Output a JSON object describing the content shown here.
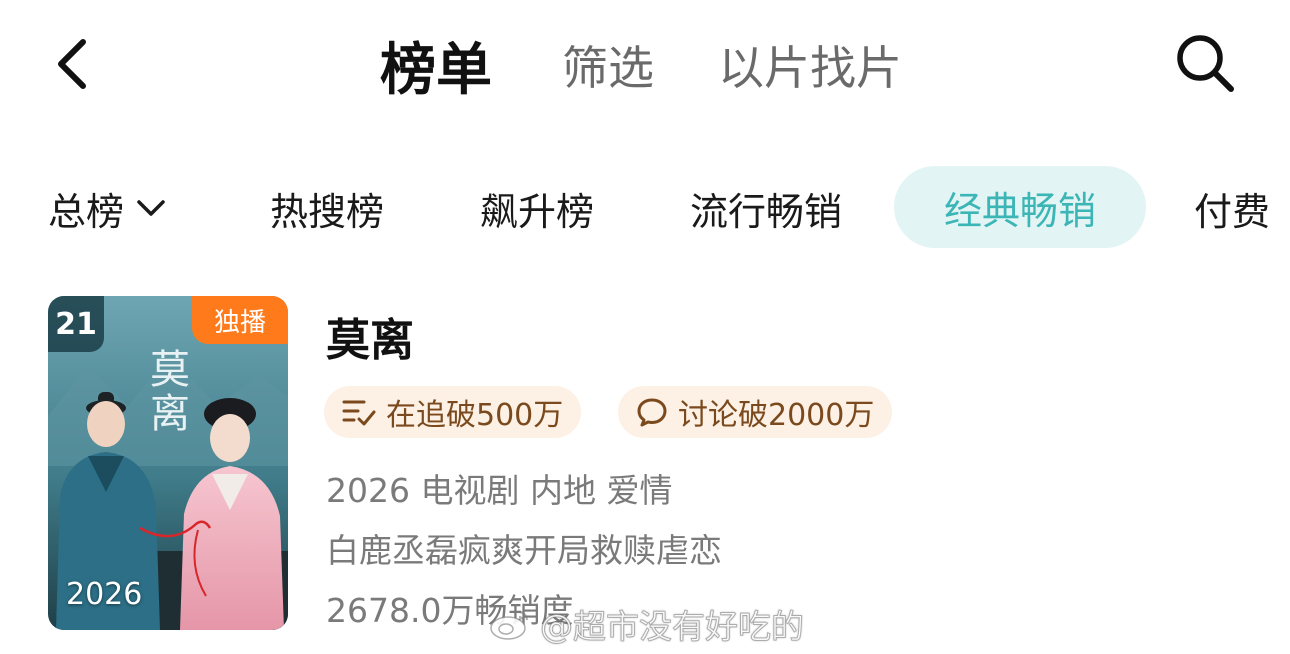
{
  "header": {
    "back_icon": "chevron-left-icon",
    "tabs": [
      {
        "label": "榜单",
        "active": true
      },
      {
        "label": "筛选",
        "active": false
      },
      {
        "label": "以片找片",
        "active": false
      }
    ],
    "search_icon": "search-icon"
  },
  "categories": [
    {
      "label": "总榜",
      "has_dropdown": true
    },
    {
      "label": "热搜榜"
    },
    {
      "label": "飙升榜"
    },
    {
      "label": "流行畅销"
    },
    {
      "label": "经典畅销",
      "active": true
    },
    {
      "label": "付费"
    }
  ],
  "item": {
    "rank": "21",
    "exclusive_badge": "独播",
    "poster_title_art": "莫离",
    "poster_year": "2026",
    "title": "莫离",
    "tags": [
      {
        "icon": "list-check-icon",
        "label": "在追破500万"
      },
      {
        "icon": "comment-icon",
        "label": "讨论破2000万"
      }
    ],
    "meta_line": "2026 电视剧 内地 爱情",
    "description": "白鹿丞磊疯爽开局救赎虐恋",
    "sales": "2678.0万畅销度"
  },
  "watermark": "@超市没有好吃的",
  "colors": {
    "accent": "#3bb5b5",
    "accent_bg": "#e2f4f4",
    "badge_orange": "#ff7a1a",
    "tag_bg": "#fdf0e4",
    "tag_text": "#7a4a1e",
    "meta_text": "#7a7a7a"
  }
}
